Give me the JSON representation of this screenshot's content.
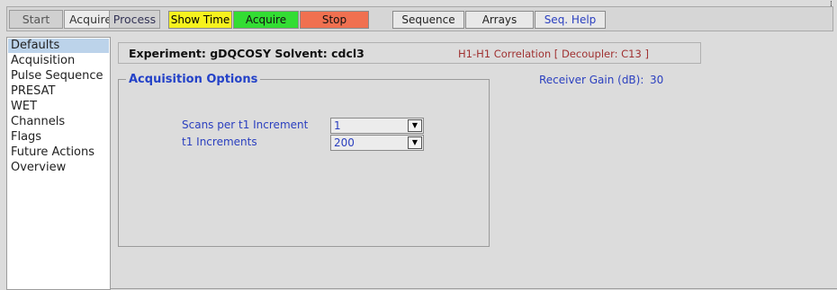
{
  "window": {
    "corner_glyph": "⁞"
  },
  "topbar": {
    "tabs": [
      {
        "label": "Start",
        "active": false
      },
      {
        "label": "Acquire",
        "active": true
      },
      {
        "label": "Process",
        "active": false
      }
    ],
    "buttons": {
      "show_time": "Show Time",
      "acquire": "Acquire",
      "stop": "Stop",
      "sequence": "Sequence",
      "arrays": "Arrays",
      "seq_help": "Seq. Help"
    },
    "colors": {
      "show_time": "#f6f21e",
      "acquire": "#33dd33",
      "stop": "#f07050"
    }
  },
  "sidebar": {
    "selected_index": 0,
    "items": [
      {
        "label": "Defaults"
      },
      {
        "label": "Acquisition"
      },
      {
        "label": "Pulse Sequence"
      },
      {
        "label": "PRESAT"
      },
      {
        "label": "WET"
      },
      {
        "label": "Channels"
      },
      {
        "label": "Flags"
      },
      {
        "label": "Future Actions"
      },
      {
        "label": "Overview"
      }
    ]
  },
  "main": {
    "experiment_line": "Experiment: gDQCOSY   Solvent: cdcl3",
    "correlation_line": "H1-H1 Correlation    [ Decoupler: C13 ]",
    "acquisition_options": {
      "title": "Acquisition Options",
      "scans_label": "Scans per t1 Increment",
      "scans_value": "1",
      "t1_label": "t1 Increments",
      "t1_value": "200"
    },
    "receiver_gain": {
      "label": "Receiver Gain (dB):",
      "value": "30"
    }
  }
}
